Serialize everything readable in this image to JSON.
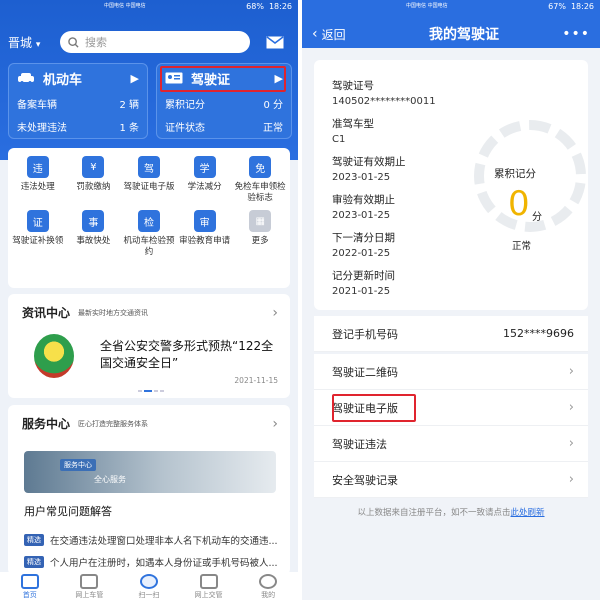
{
  "left": {
    "status": {
      "carrier": "中国电信 中国电信",
      "battery": "68%",
      "time": "18:26"
    },
    "city": "晋城",
    "search_placeholder": "搜索",
    "vehicle_card": {
      "title": "机动车",
      "row1_label": "备案车辆",
      "row1_value": "2 辆",
      "row2_label": "未处理违法",
      "row2_value": "1 条"
    },
    "license_card": {
      "title": "驾驶证",
      "row1_label": "累积记分",
      "row1_value": "0 分",
      "row2_label": "证件状态",
      "row2_value": "正常"
    },
    "services": [
      {
        "label": "违法处理",
        "color": "#2f73dd",
        "glyph": "违"
      },
      {
        "label": "罚款缴纳",
        "color": "#2f73dd",
        "glyph": "¥"
      },
      {
        "label": "驾驶证电子版",
        "color": "#2f73dd",
        "glyph": "驾"
      },
      {
        "label": "学法减分",
        "color": "#2f73dd",
        "glyph": "学"
      },
      {
        "label": "免检车申领检验标志",
        "color": "#2f73dd",
        "glyph": "免"
      },
      {
        "label": "驾驶证补换领",
        "color": "#2f73dd",
        "glyph": "证"
      },
      {
        "label": "事故快处",
        "color": "#2f73dd",
        "glyph": "事"
      },
      {
        "label": "机动车检验预约",
        "color": "#2f73dd",
        "glyph": "检"
      },
      {
        "label": "审验教育申请",
        "color": "#2f73dd",
        "glyph": "审"
      },
      {
        "label": "更多",
        "color": "#c7ccd6",
        "glyph": "▦"
      }
    ],
    "news": {
      "title": "资讯中心",
      "subtitle": "最新实时地方交通资讯",
      "headline": "全省公安交警多形式预热“122全国交通安全日”",
      "date": "2021-11-15"
    },
    "service_center": {
      "title": "服务中心",
      "subtitle": "匠心打造完整服务体系",
      "banner_tag": "服务中心",
      "banner_text": "全心服务",
      "faq_title": "用户常见问题解答",
      "faqs": [
        {
          "tag": "精选",
          "text": "在交通违法处理窗口处理非本人名下机动车的交通违..."
        },
        {
          "tag": "精选",
          "text": "个人用户在注册时，如遇本人身份证或手机号码被人..."
        }
      ]
    },
    "tabs": [
      {
        "label": "首页",
        "active": true
      },
      {
        "label": "网上车管",
        "active": false
      },
      {
        "label": "扫一扫",
        "active": false
      },
      {
        "label": "网上交管",
        "active": false
      },
      {
        "label": "我的",
        "active": false
      }
    ]
  },
  "right": {
    "status": {
      "carrier": "中国电信 中国电信",
      "battery": "67%",
      "time": "18:26"
    },
    "back_label": "返回",
    "title": "我的驾驶证",
    "more": "•••",
    "fields": [
      {
        "label": "驾驶证号",
        "value": "140502********0011"
      },
      {
        "label": "准驾车型",
        "value": "C1"
      },
      {
        "label": "驾驶证有效期止",
        "value": "2023-01-25"
      },
      {
        "label": "审验有效期止",
        "value": "2023-01-25"
      },
      {
        "label": "下一清分日期",
        "value": "2022-01-25"
      },
      {
        "label": "记分更新时间",
        "value": "2021-01-25"
      }
    ],
    "score": {
      "label": "累积记分",
      "value": "0",
      "unit": "分",
      "state": "正常"
    },
    "phone": {
      "label": "登记手机号码",
      "value": "152****9696"
    },
    "menu": [
      "驾驶证二维码",
      "驾驶证电子版",
      "驾驶证违法",
      "安全驾驶记录"
    ],
    "note_prefix": "以上数据来自注册平台，如不一致请点击",
    "note_link": "此处刷新"
  }
}
